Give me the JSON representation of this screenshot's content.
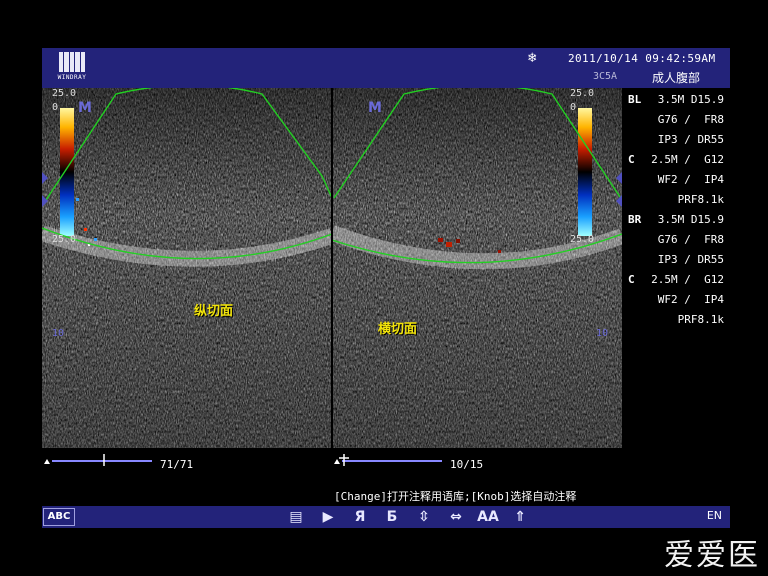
{
  "header": {
    "logo_text": "WINDRAY",
    "datetime": "2011/10/14  09:42:59AM",
    "probe": "3C5A",
    "preset": "成人腹部"
  },
  "images": {
    "left": {
      "scale_top": "25.0",
      "scale_zero": "0",
      "scale_bottom": "25.0",
      "depth_mark": "10",
      "annotation": "纵切面"
    },
    "right": {
      "scale_top": "25.0",
      "scale_zero": "0",
      "scale_bottom": "25.0",
      "depth_mark": "10",
      "annotation": "横切面"
    }
  },
  "params": [
    {
      "tag": "BL",
      "val": "3.5M D15.9"
    },
    {
      "tag": "",
      "val": "G76 /  FR8"
    },
    {
      "tag": "",
      "val": "IP3 / DR55"
    },
    {
      "tag": "C",
      "val": "2.5M /  G12"
    },
    {
      "tag": "",
      "val": "WF2 /  IP4"
    },
    {
      "tag": "",
      "val": "PRF8.1k"
    },
    {
      "tag": "BR",
      "val": "3.5M D15.9"
    },
    {
      "tag": "",
      "val": "G76 /  FR8"
    },
    {
      "tag": "",
      "val": "IP3 / DR55"
    },
    {
      "tag": "C",
      "val": "2.5M /  G12"
    },
    {
      "tag": "",
      "val": "WF2 /  IP4"
    },
    {
      "tag": "",
      "val": "PRF8.1k"
    }
  ],
  "cine": {
    "left_counter": "71/71",
    "right_counter": "10/15"
  },
  "hint": "[Change]打开注释用语库;[Knob]选择自动注释",
  "toolbar": {
    "abc_label": "ABC",
    "icons": [
      "text-icon",
      "arrow-icon",
      "letter-r-icon",
      "letter-b-icon",
      "move-icon",
      "resize-icon",
      "font-size-icon",
      "up-arrow-icon"
    ],
    "glyphs": [
      "▤",
      "▶",
      "Я",
      "Ƃ",
      "⇳",
      "⇔",
      "AA",
      "⇑"
    ],
    "lang": "EN"
  },
  "watermark": "爱爱医"
}
